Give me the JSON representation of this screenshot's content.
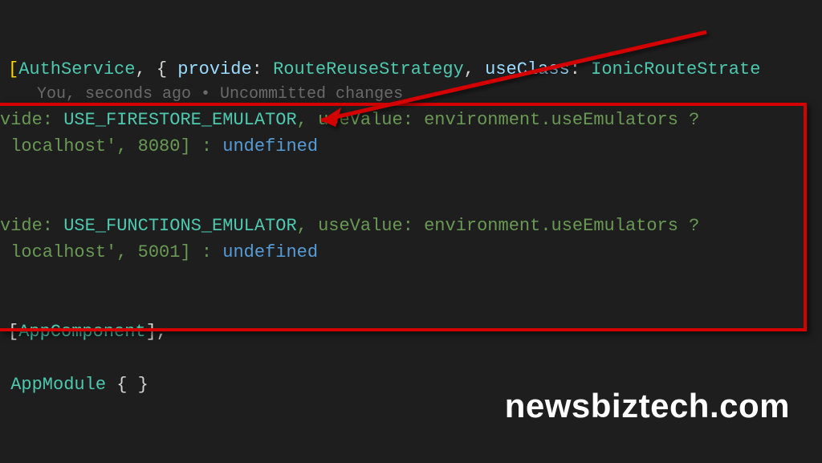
{
  "codelens": "You, seconds ago • Uncommitted changes",
  "line1": {
    "open": "[",
    "t1": "AuthService",
    "p1": ", { ",
    "k1": "provide",
    "p2": ": ",
    "t2": "RouteReuseStrategy",
    "p3": ", ",
    "k2": "useClass",
    "p4": ": ",
    "t3": "IonicRouteStrate"
  },
  "line2": {
    "a": "vide: ",
    "b": "USE_FIRESTORE_EMULATOR",
    "c": ", useValue: environment.useEmulators ?"
  },
  "line3": {
    "a": " localhost', ",
    "b": "8080",
    "c": "] : ",
    "d": "undefined"
  },
  "line4": {
    "a": "vide: ",
    "b": "USE_FUNCTIONS_EMULATOR",
    "c": ", useValue: environment.useEmulators ?"
  },
  "line5": {
    "a": " localhost', ",
    "b": "5001",
    "c": "] : ",
    "d": "undefined"
  },
  "line6": {
    "a": "[",
    "b": "AppComponent",
    "c": "],"
  },
  "line7": {
    "a": " ",
    "b": "AppModule",
    "c": " { }"
  },
  "watermark": "newsbiztech.com"
}
